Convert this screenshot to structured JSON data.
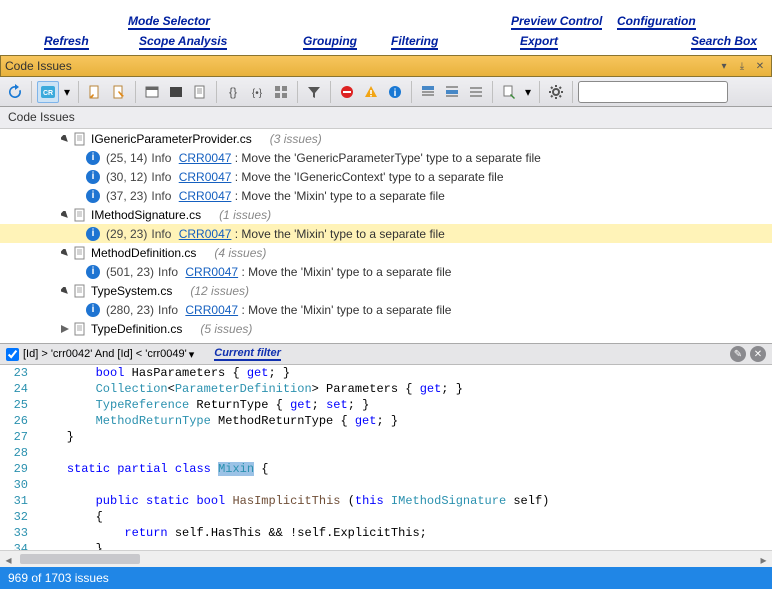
{
  "annotations": {
    "refresh": "Refresh",
    "mode": "Mode Selector",
    "scope": "Scope Analysis",
    "grouping": "Grouping",
    "filtering": "Filtering",
    "preview": "Preview Control",
    "export": "Export",
    "config": "Configuration",
    "search": "Search Box"
  },
  "window": {
    "title": "Code Issues"
  },
  "section_header": "Code Issues",
  "tree": {
    "files": [
      {
        "name": "IGenericParameterProvider.cs",
        "count": "(3 issues)"
      },
      {
        "name": "IMethodSignature.cs",
        "count": "(1 issues)"
      },
      {
        "name": "MethodDefinition.cs",
        "count": "(4 issues)"
      },
      {
        "name": "TypeSystem.cs",
        "count": "(12 issues)"
      },
      {
        "name": "TypeDefinition.cs",
        "count": "(5 issues)"
      }
    ],
    "entries": [
      {
        "loc": "(25, 14)",
        "level": "Info",
        "rule": "CRR0047",
        "msg": ":  Move the 'GenericParameterType' type to a separate file"
      },
      {
        "loc": "(30, 12)",
        "level": "Info",
        "rule": "CRR0047",
        "msg": ":  Move the 'IGenericContext' type to a separate file"
      },
      {
        "loc": "(37, 23)",
        "level": "Info",
        "rule": "CRR0047",
        "msg": ":  Move the 'Mixin' type to a separate file"
      },
      {
        "loc": "(29, 23)",
        "level": "Info",
        "rule": "CRR0047",
        "msg": ":  Move the 'Mixin' type to a separate file"
      },
      {
        "loc": "(501, 23)",
        "level": "Info",
        "rule": "CRR0047",
        "msg": ":  Move the 'Mixin' type to a separate file"
      },
      {
        "loc": "(280, 23)",
        "level": "Info",
        "rule": "CRR0047",
        "msg": ":  Move the 'Mixin' type to a separate file"
      }
    ]
  },
  "filter": {
    "expr": "[Id] > 'crr0042' And [Id] < 'crr0049'",
    "label": "Current filter"
  },
  "code": {
    "start": 23
  },
  "status": "969 of 1703 issues"
}
